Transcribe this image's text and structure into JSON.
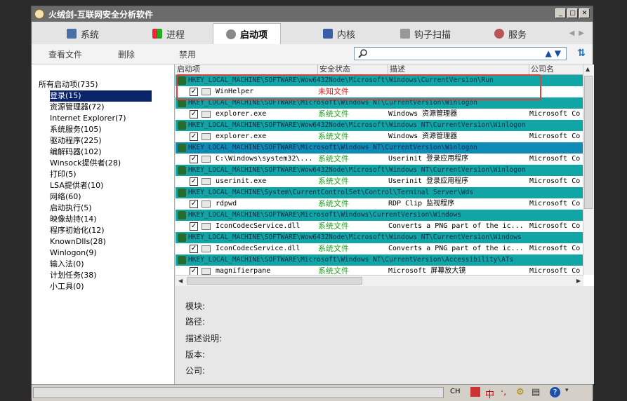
{
  "window": {
    "title": "火绒剑-互联网安全分析软件"
  },
  "tabs": [
    {
      "label": "系统",
      "icon": "monitor-icon"
    },
    {
      "label": "进程",
      "icon": "windows-logo-icon"
    },
    {
      "label": "启动项",
      "icon": "gear-icon"
    },
    {
      "label": "内核",
      "icon": "kernel-icon"
    },
    {
      "label": "钩子扫描",
      "icon": "hook-icon"
    },
    {
      "label": "服务",
      "icon": "service-icon"
    }
  ],
  "toolbar": {
    "view_file": "查看文件",
    "delete": "删除",
    "disable": "禁用",
    "search_placeholder": ""
  },
  "tree": {
    "root": "所有启动项(735)",
    "items": [
      "登录(15)",
      "资源管理器(72)",
      "Internet Explorer(7)",
      "系统服务(105)",
      "驱动程序(225)",
      "编解码器(102)",
      "Winsock提供者(28)",
      "打印(5)",
      "LSA提供者(10)",
      "网络(60)",
      "启动执行(5)",
      "映像劫持(14)",
      "程序初始化(12)",
      "KnownDlls(28)",
      "Winlogon(9)",
      "输入法(0)",
      "计划任务(38)",
      "小工具(0)"
    ],
    "selected_index": 0
  },
  "columns": [
    "启动项",
    "安全状态",
    "描述",
    "公司名"
  ],
  "groups": [
    {
      "key": "HKEY_LOCAL_MACHINE\\SOFTWARE\\Wow6432Node\\Microsoft\\Windows\\CurrentVersion\\Run",
      "row": {
        "name": "WinHelper",
        "status": "未知文件",
        "desc": "",
        "company": ""
      }
    },
    {
      "key": "HKEY_LOCAL_MACHINE\\SOFTWARE\\Microsoft\\Windows NT\\CurrentVersion\\Winlogon",
      "row": {
        "name": "explorer.exe",
        "status": "系统文件",
        "desc": "Windows 资源管理器",
        "company": "Microsoft Co"
      }
    },
    {
      "key": "HKEY_LOCAL_MACHINE\\SOFTWARE\\Wow6432Node\\Microsoft\\Windows NT\\CurrentVersion\\Winlogon",
      "row": {
        "name": "explorer.exe",
        "status": "系统文件",
        "desc": "Windows 资源管理器",
        "company": "Microsoft Co"
      }
    },
    {
      "key": "HKEY_LOCAL_MACHINE\\SOFTWARE\\Microsoft\\Windows NT\\CurrentVersion\\Winlogon",
      "row": {
        "name": "C:\\Windows\\system32\\...",
        "status": "系统文件",
        "desc": "Userinit 登录应用程序",
        "company": "Microsoft Co"
      }
    },
    {
      "key": "HKEY_LOCAL_MACHINE\\SOFTWARE\\Wow6432Node\\Microsoft\\Windows NT\\CurrentVersion\\Winlogon",
      "row": {
        "name": "userinit.exe",
        "status": "系统文件",
        "desc": "Userinit 登录应用程序",
        "company": "Microsoft Co"
      }
    },
    {
      "key": "HKEY_LOCAL_MACHINE\\System\\CurrentControlSet\\Control\\Terminal Server\\Wds",
      "row": {
        "name": "rdpwd",
        "status": "系统文件",
        "desc": "RDP Clip 监视程序",
        "company": "Microsoft Co"
      }
    },
    {
      "key": "HKEY_LOCAL_MACHINE\\SOFTWARE\\Microsoft\\Windows\\CurrentVersion\\Windows",
      "row": {
        "name": "IconCodecService.dll",
        "status": "系统文件",
        "desc": "Converts a PNG part of the ic...",
        "company": "Microsoft Co"
      }
    },
    {
      "key": "HKEY_LOCAL_MACHINE\\SOFTWARE\\Wow6432Node\\Microsoft\\Windows NT\\CurrentVersion\\Windows",
      "row": {
        "name": "IconCodecService.dll",
        "status": "系统文件",
        "desc": "Converts a PNG part of the ic...",
        "company": "Microsoft Co"
      }
    },
    {
      "key": "HKEY_LOCAL_MACHINE\\SOFTWARE\\Microsoft\\Windows NT\\CurrentVersion\\Accessibility\\ATs",
      "row": {
        "name": "magnifierpane",
        "status": "系统文件",
        "desc": "Microsoft 屏幕放大镜",
        "company": "Microsoft Co"
      }
    }
  ],
  "details": {
    "module": "模块:",
    "path": "路径:",
    "description": "描述说明:",
    "version": "版本:",
    "company": "公司:"
  },
  "statusbar": {
    "lang": "CH",
    "ime": "中"
  },
  "colors": {
    "group_teal": "#12a5a5",
    "group_blue": "#0f8cb5",
    "system_file": "#22a022",
    "unknown_file": "#d02020",
    "selection": "#0a246a"
  }
}
